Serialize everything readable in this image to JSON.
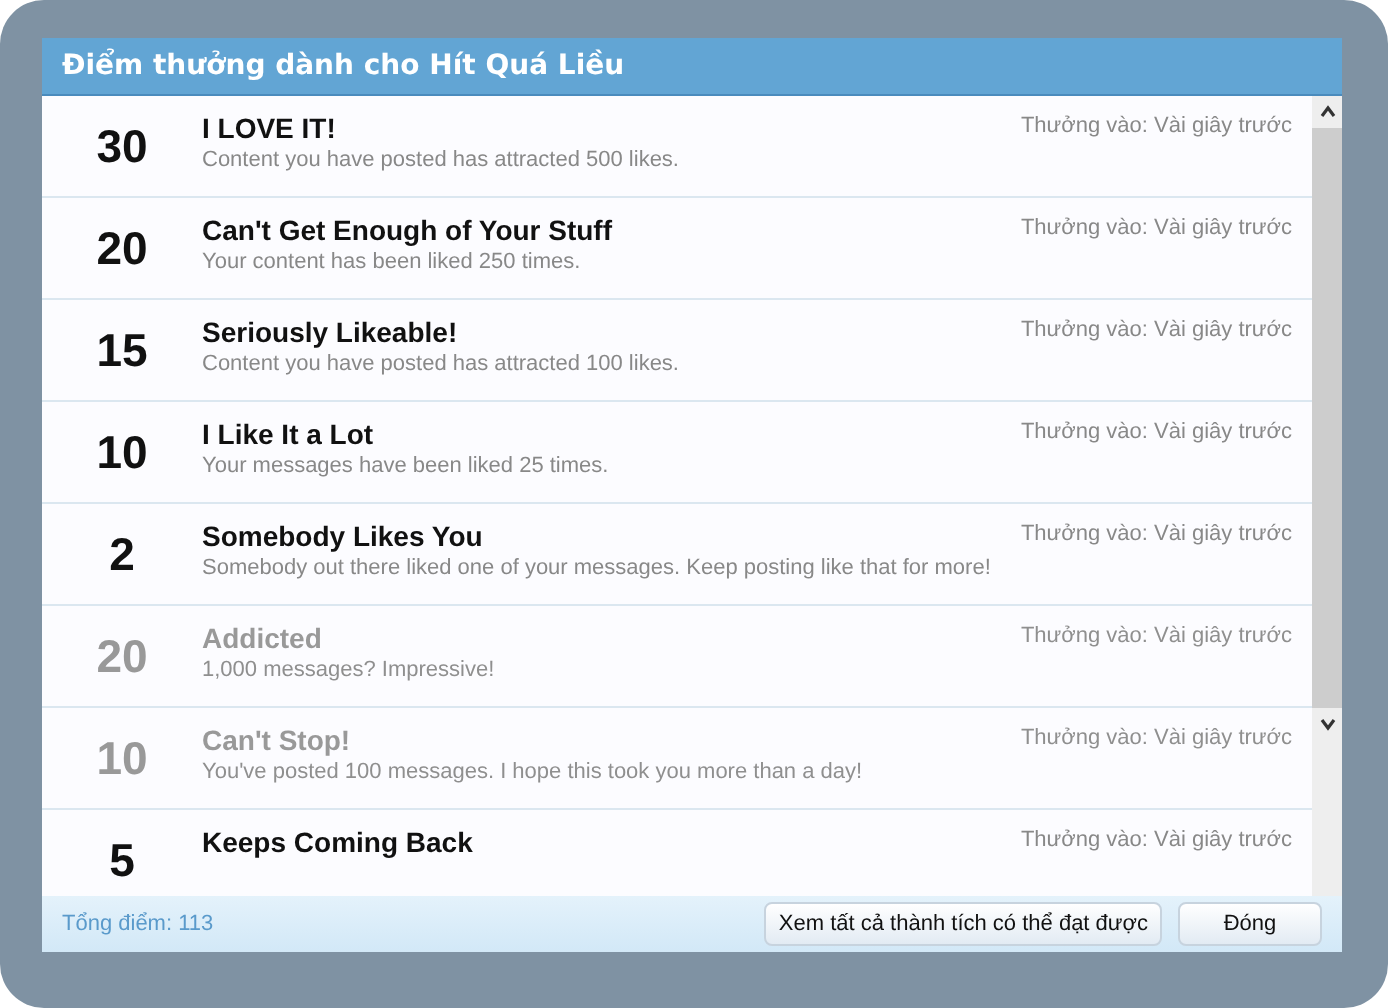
{
  "dialog": {
    "title": "Điểm thưởng dành cho Hít Quá Liều"
  },
  "awards": [
    {
      "points": "30",
      "title": "I LOVE IT!",
      "description": "Content you have posted has attracted 500 likes.",
      "awarded": "Thưởng vào: Vài giây trước",
      "faded": false
    },
    {
      "points": "20",
      "title": "Can't Get Enough of Your Stuff",
      "description": "Your content has been liked 250 times.",
      "awarded": "Thưởng vào: Vài giây trước",
      "faded": false
    },
    {
      "points": "15",
      "title": "Seriously Likeable!",
      "description": "Content you have posted has attracted 100 likes.",
      "awarded": "Thưởng vào: Vài giây trước",
      "faded": false
    },
    {
      "points": "10",
      "title": "I Like It a Lot",
      "description": "Your messages have been liked 25 times.",
      "awarded": "Thưởng vào: Vài giây trước",
      "faded": false
    },
    {
      "points": "2",
      "title": "Somebody Likes You",
      "description": "Somebody out there liked one of your messages. Keep posting like that for more!",
      "awarded": "Thưởng vào: Vài giây trước",
      "faded": false
    },
    {
      "points": "20",
      "title": "Addicted",
      "description": "1,000 messages? Impressive!",
      "awarded": "Thưởng vào: Vài giây trước",
      "faded": true
    },
    {
      "points": "10",
      "title": "Can't Stop!",
      "description": "You've posted 100 messages. I hope this took you more than a day!",
      "awarded": "Thưởng vào: Vài giây trước",
      "faded": true
    },
    {
      "points": "5",
      "title": "Keeps Coming Back",
      "awarded": "Thưởng vào: Vài giây trước",
      "faded": false
    }
  ],
  "footer": {
    "total": "Tổng điểm: 113",
    "buttons": [
      "Xem tất cả thành tích có thể đạt được",
      "Đóng"
    ]
  }
}
